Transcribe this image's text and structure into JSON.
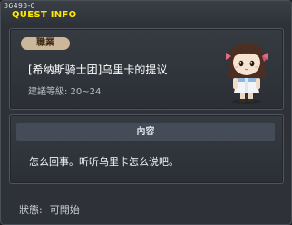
{
  "window": {
    "quest_id": "36493-0",
    "title": "QUEST INFO"
  },
  "quest": {
    "job_badge": "職業",
    "name": "[希纳斯骑士团]乌里卡的提议",
    "level_line": "建議等級: 20~24"
  },
  "content": {
    "header": "內容",
    "text": "怎么回事。听听乌里卡怎么说吧。"
  },
  "status": {
    "label": "狀態:",
    "value": "可開始"
  },
  "icons": {
    "npc": "npc-girl-portrait-icon"
  }
}
